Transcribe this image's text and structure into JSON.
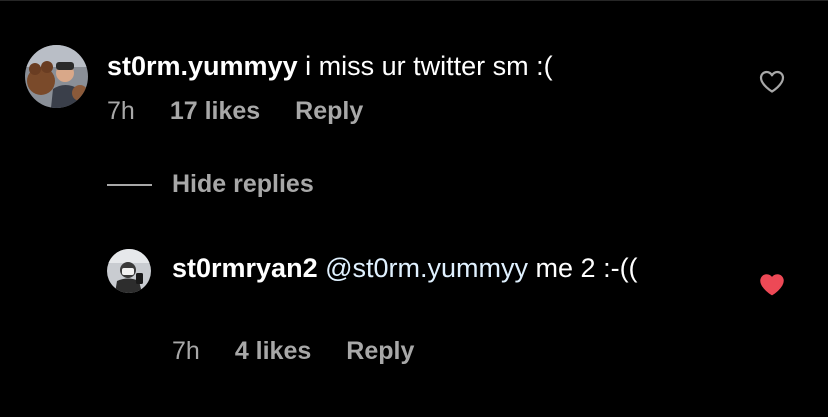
{
  "colors": {
    "background": "#000000",
    "text_primary": "#ffffff",
    "text_secondary": "#a8a8a8",
    "mention": "#e0f1ff",
    "like_active": "#ed4956",
    "like_outline": "#a8a8a8"
  },
  "comment": {
    "username": "st0rm.yummyy",
    "text": "i miss ur twitter sm :(",
    "time": "7h",
    "likes": "17 likes",
    "reply_label": "Reply",
    "liked": false,
    "like_icon": "heart-outline-icon",
    "avatar_icon": "profile-avatar"
  },
  "replies_toggle": {
    "label": "Hide replies"
  },
  "reply": {
    "username": "st0rmryan2",
    "mention": "@st0rm.yummyy",
    "text": "me 2 :-((",
    "time": "7h",
    "likes": "4 likes",
    "reply_label": "Reply",
    "liked": true,
    "like_icon": "heart-filled-icon",
    "avatar_icon": "profile-avatar"
  }
}
